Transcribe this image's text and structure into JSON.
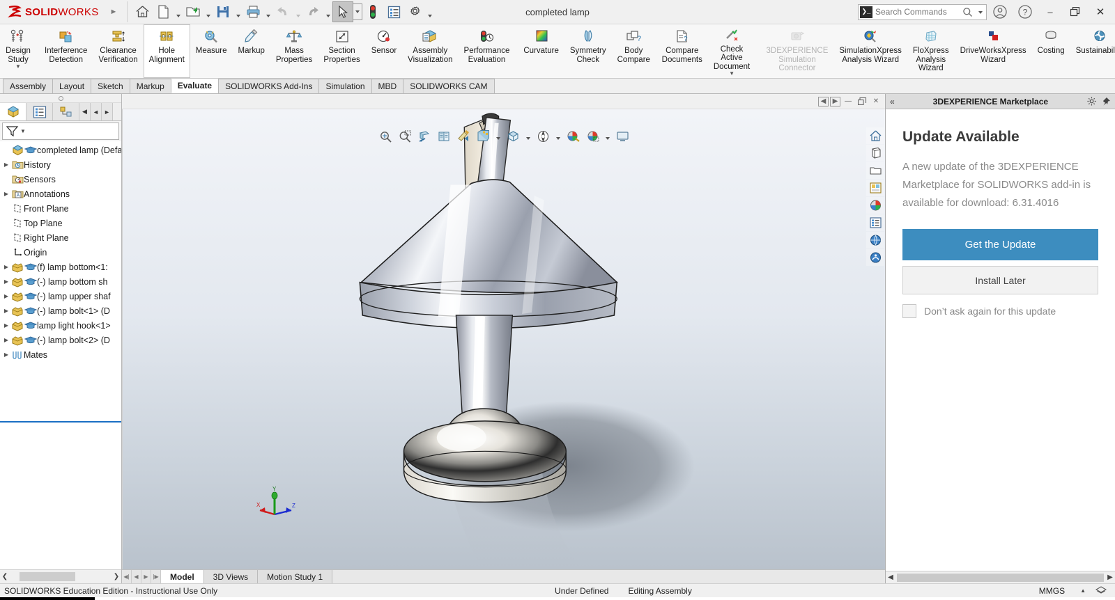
{
  "app": {
    "brand_ds": "2S",
    "brand_name_bold": "SOLID",
    "brand_name_light": "WORKS",
    "document_title": "completed lamp"
  },
  "titlebar": {
    "quick_access": [
      {
        "name": "home-icon",
        "label": "Home"
      },
      {
        "name": "new-document-icon",
        "label": "New"
      },
      {
        "name": "open-document-icon",
        "label": "Open"
      },
      {
        "name": "save-icon",
        "label": "Save"
      },
      {
        "name": "print-icon",
        "label": "Print"
      },
      {
        "name": "undo-icon",
        "label": "Undo"
      },
      {
        "name": "redo-icon",
        "label": "Redo"
      },
      {
        "name": "select-cursor-icon",
        "label": "Select"
      },
      {
        "name": "rebuild-icon",
        "label": "Rebuild"
      },
      {
        "name": "options-list-icon",
        "label": "File Properties"
      },
      {
        "name": "gear-icon",
        "label": "Options"
      }
    ],
    "search": {
      "placeholder": "Search Commands",
      "value": ""
    },
    "account_icon": "user-account-icon",
    "help_icon": "help-question-icon",
    "window_minimize": "–",
    "window_restore": "❐",
    "window_close": "✕"
  },
  "ribbon": {
    "groups": [
      {
        "items": [
          {
            "label": "Design\nStudy",
            "icon": "design-study-icon",
            "dropdown": true,
            "state": "normal",
            "name": "design-study"
          }
        ]
      },
      {
        "items": [
          {
            "label": "Interference\nDetection",
            "icon": "interference-detection-icon",
            "state": "normal",
            "name": "interference-detection"
          },
          {
            "label": "Clearance\nVerification",
            "icon": "clearance-verification-icon",
            "state": "normal",
            "name": "clearance-verification"
          },
          {
            "label": "Hole\nAlignment",
            "icon": "hole-alignment-icon",
            "state": "selected",
            "name": "hole-alignment"
          },
          {
            "label": "Measure",
            "icon": "measure-icon",
            "state": "normal",
            "name": "measure"
          },
          {
            "label": "Markup",
            "icon": "markup-icon",
            "state": "normal",
            "name": "markup"
          },
          {
            "label": "Mass\nProperties",
            "icon": "mass-properties-icon",
            "state": "normal",
            "name": "mass-properties"
          },
          {
            "label": "Section\nProperties",
            "icon": "section-properties-icon",
            "state": "normal",
            "name": "section-properties"
          },
          {
            "label": "Sensor",
            "icon": "sensor-icon",
            "state": "normal",
            "name": "sensor"
          },
          {
            "label": "Assembly\nVisualization",
            "icon": "assembly-visualization-icon",
            "state": "normal",
            "name": "assembly-visualization"
          },
          {
            "label": "Performance\nEvaluation",
            "icon": "performance-evaluation-icon",
            "state": "normal",
            "name": "performance-evaluation"
          }
        ]
      },
      {
        "items": [
          {
            "label": "Curvature",
            "icon": "curvature-icon",
            "state": "normal",
            "name": "curvature"
          },
          {
            "label": "Symmetry\nCheck",
            "icon": "symmetry-check-icon",
            "state": "normal",
            "name": "symmetry-check"
          },
          {
            "label": "Body\nCompare",
            "icon": "body-compare-icon",
            "state": "normal",
            "name": "body-compare"
          }
        ]
      },
      {
        "items": [
          {
            "label": "Compare\nDocuments",
            "icon": "compare-documents-icon",
            "state": "normal",
            "name": "compare-documents"
          },
          {
            "label": "Check Active\nDocument",
            "icon": "check-active-document-icon",
            "dropdown": true,
            "state": "normal",
            "name": "check-active-document"
          }
        ]
      },
      {
        "items": [
          {
            "label": "3DEXPERIENCE\nSimulation\nConnector",
            "icon": "3dexperience-simulation-connector-icon",
            "state": "disabled",
            "name": "3dexperience-simulation-connector"
          },
          {
            "label": "SimulationXpress\nAnalysis Wizard",
            "icon": "simulationxpress-icon",
            "state": "normal",
            "name": "simulationxpress-analysis-wizard"
          },
          {
            "label": "FloXpress\nAnalysis\nWizard",
            "icon": "floxpress-icon",
            "state": "normal",
            "name": "floxpress-analysis-wizard"
          },
          {
            "label": "DriveWorksXpress\nWizard",
            "icon": "driveworksxpress-icon",
            "state": "normal",
            "name": "driveworksxpress-wizard"
          },
          {
            "label": "Costing",
            "icon": "costing-icon",
            "state": "normal",
            "name": "costing"
          },
          {
            "label": "Sustainability",
            "icon": "sustainability-icon",
            "state": "normal",
            "name": "sustainability"
          }
        ]
      }
    ],
    "expand_icon": "»",
    "collapse_icon": "∧"
  },
  "command_tabs": [
    {
      "label": "Assembly",
      "active": false
    },
    {
      "label": "Layout",
      "active": false
    },
    {
      "label": "Sketch",
      "active": false
    },
    {
      "label": "Markup",
      "active": false
    },
    {
      "label": "Evaluate",
      "active": true
    },
    {
      "label": "SOLIDWORKS Add-Ins",
      "active": false
    },
    {
      "label": "Simulation",
      "active": false
    },
    {
      "label": "MBD",
      "active": false
    },
    {
      "label": "SOLIDWORKS CAM",
      "active": false
    }
  ],
  "left_panel": {
    "tabs": [
      {
        "name": "feature-manager-tree-tab",
        "icon": "feature-tree-icon",
        "active": true
      },
      {
        "name": "property-manager-tab",
        "icon": "property-manager-icon",
        "active": false
      },
      {
        "name": "configuration-manager-tab",
        "icon": "configuration-manager-icon",
        "active": false
      },
      {
        "name": "display-manager-tab",
        "icon": "display-manager-icon",
        "active": false
      }
    ],
    "nav_prev": "◄",
    "nav_next": "►",
    "filter_icon": "filter-funnel-icon",
    "tree": [
      {
        "label": "completed lamp (Defau",
        "icon": "assembly-icon",
        "icon2": "education-cap-icon",
        "expandable": false,
        "indent": 0,
        "root": true
      },
      {
        "label": "History",
        "icon": "history-folder-icon",
        "expandable": true,
        "indent": 1
      },
      {
        "label": "Sensors",
        "icon": "sensors-folder-icon",
        "expandable": false,
        "indent": 1
      },
      {
        "label": "Annotations",
        "icon": "annotations-folder-icon",
        "expandable": true,
        "indent": 1
      },
      {
        "label": "Front Plane",
        "icon": "plane-icon",
        "expandable": false,
        "indent": 1
      },
      {
        "label": "Top Plane",
        "icon": "plane-icon",
        "expandable": false,
        "indent": 1
      },
      {
        "label": "Right Plane",
        "icon": "plane-icon",
        "expandable": false,
        "indent": 1
      },
      {
        "label": "Origin",
        "icon": "origin-icon",
        "expandable": false,
        "indent": 1
      },
      {
        "label": "(f) lamp bottom<1:",
        "icon": "part-icon",
        "icon2": "education-cap-icon",
        "expandable": true,
        "indent": 1
      },
      {
        "label": "(-) lamp bottom sh",
        "icon": "part-icon",
        "icon2": "education-cap-icon",
        "expandable": true,
        "indent": 1
      },
      {
        "label": "(-) lamp upper shaf",
        "icon": "part-icon",
        "icon2": "education-cap-icon",
        "expandable": true,
        "indent": 1
      },
      {
        "label": "(-) lamp bolt<1> (D",
        "icon": "part-icon",
        "icon2": "education-cap-icon",
        "expandable": true,
        "indent": 1
      },
      {
        "label": "lamp light hook<1>",
        "icon": "part-icon",
        "icon2": "education-cap-icon",
        "expandable": true,
        "indent": 1
      },
      {
        "label": "(-) lamp bolt<2> (D",
        "icon": "part-icon",
        "icon2": "education-cap-icon",
        "expandable": true,
        "indent": 1
      },
      {
        "label": "Mates",
        "icon": "mates-icon",
        "expandable": true,
        "indent": 1
      }
    ]
  },
  "viewport": {
    "window_controls": [
      {
        "name": "restore-left-icon",
        "glyph": "◄"
      },
      {
        "name": "restore-right-icon",
        "glyph": "►"
      },
      {
        "name": "minimize-icon",
        "glyph": "—"
      },
      {
        "name": "restore-down-icon",
        "glyph": "❐"
      },
      {
        "name": "close-document-icon",
        "glyph": "✕"
      }
    ],
    "view_toolbar": [
      {
        "name": "zoom-to-fit-icon"
      },
      {
        "name": "zoom-to-area-icon"
      },
      {
        "name": "section-view-icon"
      },
      {
        "name": "view-orientation-icon"
      },
      {
        "name": "previous-view-icon"
      },
      {
        "name": "display-style-icon",
        "dropdown": true
      },
      {
        "name": "hide-show-items-icon",
        "dropdown": true
      },
      {
        "name": "edit-appearance-icon",
        "dropdown": true
      },
      {
        "name": "apply-scene-icon",
        "dropdown": true
      },
      {
        "name": "view-settings-icon",
        "dropdown": true
      }
    ],
    "right_toolbar": [
      {
        "name": "view-home-icon"
      },
      {
        "name": "view-model-icon"
      },
      {
        "name": "open-folder-icon"
      },
      {
        "name": "view-layout-icon"
      },
      {
        "name": "appearances-icon"
      },
      {
        "name": "custom-properties-icon"
      },
      {
        "name": "3d-content-central-icon"
      },
      {
        "name": "solidworks-forum-icon"
      }
    ],
    "triad": {
      "x_label": "X",
      "y_label": "Y",
      "z_label": "Z"
    },
    "model_name": "completed lamp"
  },
  "bottom_tabs": {
    "nav": [
      "◀│",
      "◀",
      "▶",
      "│▶"
    ],
    "tabs": [
      {
        "label": "Model",
        "active": true
      },
      {
        "label": "3D Views",
        "active": false
      },
      {
        "label": "Motion Study 1",
        "active": false
      }
    ]
  },
  "task_pane": {
    "collapse_icon": "«",
    "title": "3DEXPERIENCE Marketplace",
    "settings_icon": "gear-icon",
    "pin_icon": "pin-icon",
    "heading": "Update Available",
    "body_text": "A new update of the 3DEXPERIENCE Marketplace for SOLIDWORKS add-in is available for download: 6.31.4016",
    "primary_button": "Get the Update",
    "secondary_button": "Install Later",
    "checkbox_label": "Don’t ask again for this update",
    "checkbox_checked": false,
    "accent_color": "#3d8dbf"
  },
  "status_bar": {
    "left_text": "SOLIDWORKS Education Edition - Instructional Use Only",
    "state": "Under Defined",
    "mode": "Editing Assembly",
    "units": "MMGS",
    "units_caret": "▲",
    "overlay_icon": "layers-icon"
  }
}
